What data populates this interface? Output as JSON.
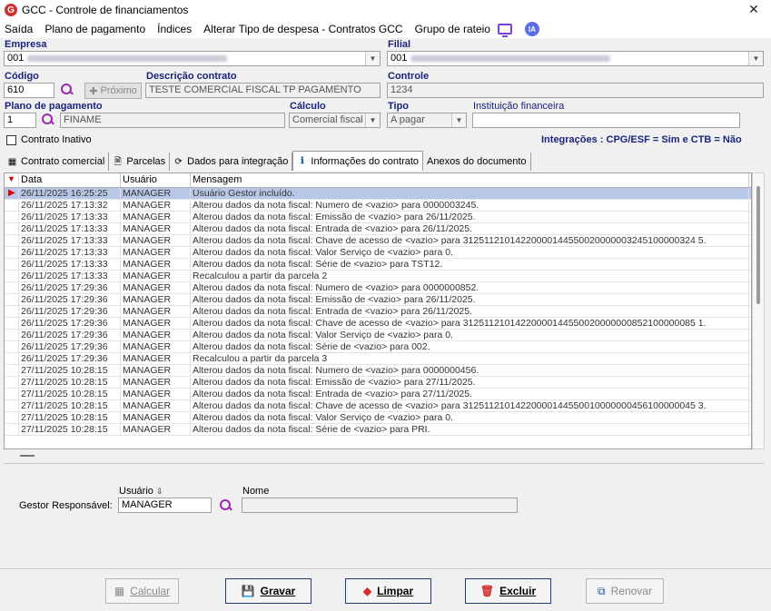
{
  "window": {
    "title": "GCC - Controle de financiamentos",
    "logo": "G"
  },
  "menu": [
    "Saída",
    "Plano de pagamento",
    "Índices",
    "Alterar Tipo de despesa - Contratos GCC",
    "Grupo de rateio"
  ],
  "menu_icons": {
    "monitor": "monitor-icon",
    "ia": "IA"
  },
  "form": {
    "empresa_label": "Empresa",
    "empresa_value": "001",
    "filial_label": "Filial",
    "filial_value": "001",
    "codigo_label": "Código",
    "codigo_value": "610",
    "proximo_label": "Próximo",
    "descricao_label": "Descrição contrato",
    "descricao_value": "TESTE COMERCIAL FISCAL TP PAGAMENTO",
    "controle_label": "Controle",
    "controle_value": "1234",
    "plano_label": "Plano de pagamento",
    "plano_code": "1",
    "plano_value": "FINAME",
    "calculo_label": "Cálculo",
    "calculo_value": "Comercial fiscal",
    "tipo_label": "Tipo",
    "tipo_value": "A pagar",
    "instituicao_label": "Instituição financeira",
    "instituicao_value": "",
    "inativo_label": "Contrato Inativo",
    "integracoes_text": "Integrações : CPG/ESF = Sim e CTB = Não"
  },
  "tabs": [
    {
      "label": "Contrato comercial",
      "icon": "table-icon"
    },
    {
      "label": "Parcelas",
      "icon": "document-icon"
    },
    {
      "label": "Dados para integração",
      "icon": "sync-icon"
    },
    {
      "label": "Informações do contrato",
      "icon": "info-icon"
    },
    {
      "label": "Anexos do documento",
      "icon": ""
    }
  ],
  "grid": {
    "headers": [
      "Data",
      "Usuário",
      "Mensagem"
    ],
    "rows": [
      [
        "26/11/2025 16:25:25",
        "MANAGER",
        "Usuário Gestor incluído."
      ],
      [
        "26/11/2025 17:13:32",
        "MANAGER",
        "Alterou dados da nota fiscal: Numero de <vazio> para 0000003245."
      ],
      [
        "26/11/2025 17:13:33",
        "MANAGER",
        "Alterou dados da nota fiscal: Emissão de <vazio> para 26/11/2025."
      ],
      [
        "26/11/2025 17:13:33",
        "MANAGER",
        "Alterou dados da nota fiscal: Entrada de <vazio> para 26/11/2025."
      ],
      [
        "26/11/2025 17:13:33",
        "MANAGER",
        "Alterou dados da nota fiscal: Chave de acesso de <vazio> para 31251121014220000144550020000003245100000324 5."
      ],
      [
        "26/11/2025 17:13:33",
        "MANAGER",
        "Alterou dados da nota fiscal: Valor Serviço de <vazio> para 0."
      ],
      [
        "26/11/2025 17:13:33",
        "MANAGER",
        "Alterou dados da nota fiscal: Série de <vazio> para TST12."
      ],
      [
        "26/11/2025 17:13:33",
        "MANAGER",
        "Recalculou a partir da parcela 2"
      ],
      [
        "26/11/2025 17:29:36",
        "MANAGER",
        "Alterou dados da nota fiscal: Numero de <vazio> para 0000000852."
      ],
      [
        "26/11/2025 17:29:36",
        "MANAGER",
        "Alterou dados da nota fiscal: Emissão de <vazio> para 26/11/2025."
      ],
      [
        "26/11/2025 17:29:36",
        "MANAGER",
        "Alterou dados da nota fiscal: Entrada de <vazio> para 26/11/2025."
      ],
      [
        "26/11/2025 17:29:36",
        "MANAGER",
        "Alterou dados da nota fiscal: Chave de acesso de <vazio> para 31251121014220000144550020000000852100000085 1."
      ],
      [
        "26/11/2025 17:29:36",
        "MANAGER",
        "Alterou dados da nota fiscal: Valor Serviço de <vazio> para 0."
      ],
      [
        "26/11/2025 17:29:36",
        "MANAGER",
        "Alterou dados da nota fiscal: Série de <vazio> para 002."
      ],
      [
        "26/11/2025 17:29:36",
        "MANAGER",
        "Recalculou a partir da parcela 3"
      ],
      [
        "27/11/2025 10:28:15",
        "MANAGER",
        "Alterou dados da nota fiscal: Numero de <vazio> para 0000000456."
      ],
      [
        "27/11/2025 10:28:15",
        "MANAGER",
        "Alterou dados da nota fiscal: Emissão de <vazio> para 27/11/2025."
      ],
      [
        "27/11/2025 10:28:15",
        "MANAGER",
        "Alterou dados da nota fiscal: Entrada de <vazio> para 27/11/2025."
      ],
      [
        "27/11/2025 10:28:15",
        "MANAGER",
        "Alterou dados da nota fiscal: Chave de acesso de <vazio> para 31251121014220000144550010000000456100000045 3."
      ],
      [
        "27/11/2025 10:28:15",
        "MANAGER",
        "Alterou dados da nota fiscal: Valor Serviço de <vazio> para 0."
      ],
      [
        "27/11/2025 10:28:15",
        "MANAGER",
        "Alterou dados da nota fiscal: Série de <vazio> para PRI."
      ]
    ]
  },
  "gestor": {
    "usuario_label": "Usuário",
    "nome_label": "Nome",
    "responsavel_label": "Gestor Responsável:",
    "usuario_value": "MANAGER",
    "nome_value": ""
  },
  "footer": {
    "calcular": "Calcular",
    "gravar": "Gravar",
    "limpar": "Limpar",
    "excluir": "Excluir",
    "renovar": "Renovar"
  }
}
